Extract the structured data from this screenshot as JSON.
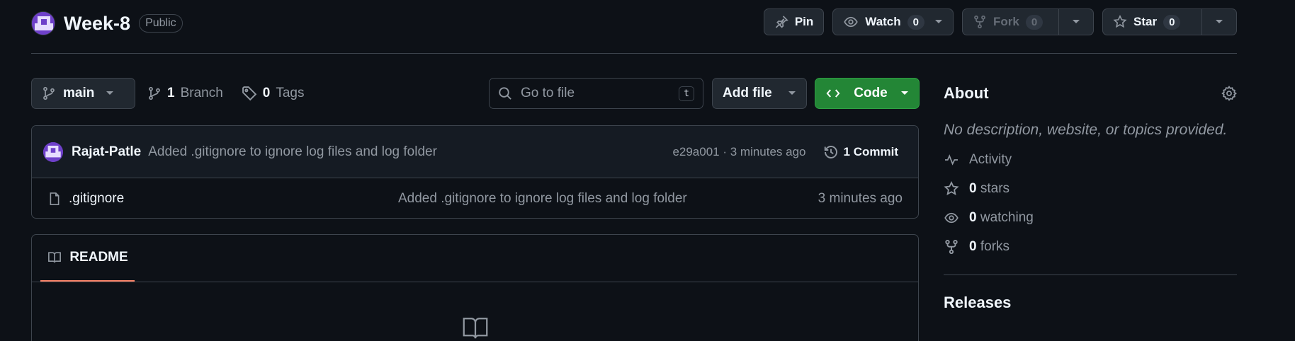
{
  "repo": {
    "name": "Week-8",
    "visibility": "Public"
  },
  "header_actions": {
    "pin_label": "Pin",
    "watch_label": "Watch",
    "watch_count": "0",
    "fork_label": "Fork",
    "fork_count": "0",
    "star_label": "Star",
    "star_count": "0"
  },
  "toolbar": {
    "branch_name": "main",
    "branch_count": "1",
    "branch_label": "Branch",
    "tag_count": "0",
    "tag_label": "Tags",
    "go_to_file_placeholder": "Go to file",
    "go_to_file_shortcut": "t",
    "add_file_label": "Add file",
    "code_label": "Code"
  },
  "latest_commit": {
    "author": "Rajat-Patle",
    "message": "Added .gitignore to ignore log files and log folder",
    "meta": "e29a001 · 3 minutes ago",
    "commit_count_label": "1 Commit"
  },
  "files": [
    {
      "name": ".gitignore",
      "message": "Added .gitignore to ignore log files and log folder",
      "age": "3 minutes ago"
    }
  ],
  "readme": {
    "tab_label": "README"
  },
  "about": {
    "title": "About",
    "description": "No description, website, or topics provided.",
    "activity_label": "Activity",
    "stars_count": "0",
    "stars_label": "stars",
    "watching_count": "0",
    "watching_label": "watching",
    "forks_count": "0",
    "forks_label": "forks"
  },
  "releases": {
    "title": "Releases"
  },
  "colors": {
    "background": "#0d1117",
    "code_button": "#238636",
    "avatar": "#6e40c9",
    "tab_underline": "#f78166"
  }
}
